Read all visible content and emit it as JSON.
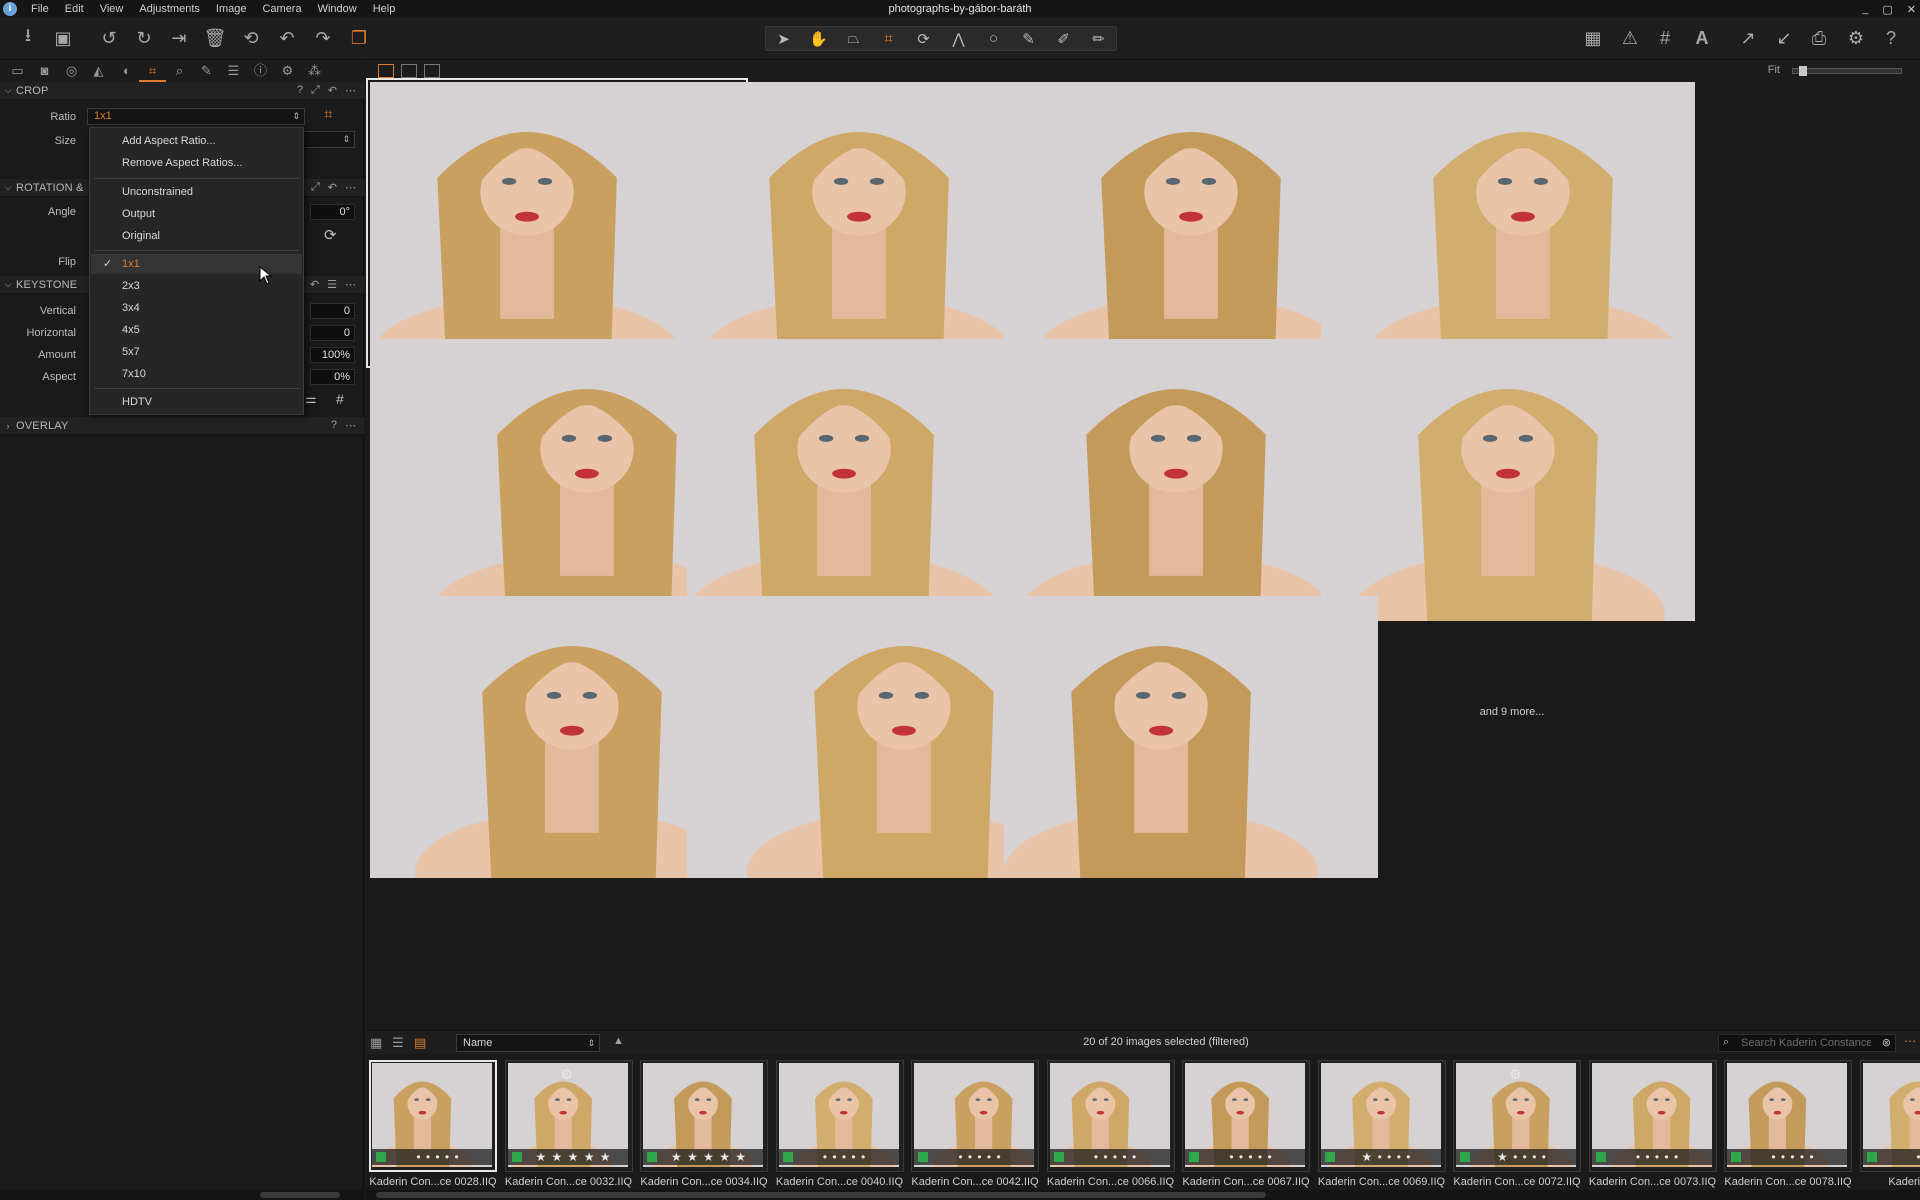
{
  "window": {
    "title": "photographs-by-gábor-baráth",
    "controls": [
      "_",
      "▢",
      "✕"
    ]
  },
  "menu": [
    "File",
    "Edit",
    "View",
    "Adjustments",
    "Image",
    "Camera",
    "Window",
    "Help"
  ],
  "left_panel": {
    "crop": {
      "title": "CROP",
      "ratio_label": "Ratio",
      "ratio_value": "1x1",
      "size_label": "Size"
    },
    "rotation": {
      "title": "ROTATION &",
      "angle_label": "Angle",
      "angle_value": "0°",
      "flip_label": "Flip"
    },
    "keystone": {
      "title": "KEYSTONE",
      "vertical_label": "Vertical",
      "vertical_value": "0",
      "horizontal_label": "Horizontal",
      "horizontal_value": "0",
      "amount_label": "Amount",
      "amount_value": "100%",
      "aspect_label": "Aspect",
      "aspect_value": "0%"
    },
    "overlay": {
      "title": "OVERLAY"
    }
  },
  "ratio_menu": {
    "add": "Add Aspect Ratio...",
    "remove": "Remove Aspect Ratios...",
    "presets": [
      "Unconstrained",
      "Output",
      "Original"
    ],
    "ratios": [
      "1x1",
      "2x3",
      "3x4",
      "4x5",
      "5x7",
      "7x10"
    ],
    "checked": "1x1",
    "extra": "HDTV"
  },
  "viewer": {
    "fit_label": "Fit",
    "more_label": "and 9 more..."
  },
  "browser": {
    "sort_value": "Name",
    "selection_text": "20 of 20 images selected (filtered)",
    "search_placeholder": "Search Kaderin Constance"
  },
  "filmstrip": [
    {
      "name": "Kaderin Con...ce 0028.IIQ",
      "stars": "• • • • •",
      "gear": false,
      "selected": true
    },
    {
      "name": "Kaderin Con...ce 0032.IIQ",
      "stars": "★ ★ ★ ★ ★",
      "gear": true,
      "selected": false
    },
    {
      "name": "Kaderin Con...ce 0034.IIQ",
      "stars": "★ ★ ★ ★ ★",
      "gear": false,
      "selected": false
    },
    {
      "name": "Kaderin Con...ce 0040.IIQ",
      "stars": "• • • • •",
      "gear": false,
      "selected": false
    },
    {
      "name": "Kaderin Con...ce 0042.IIQ",
      "stars": "• • • • •",
      "gear": false,
      "selected": false
    },
    {
      "name": "Kaderin Con...ce 0066.IIQ",
      "stars": "• • • • •",
      "gear": false,
      "selected": false
    },
    {
      "name": "Kaderin Con...ce 0067.IIQ",
      "stars": "• • • • •",
      "gear": false,
      "selected": false
    },
    {
      "name": "Kaderin Con...ce 0069.IIQ",
      "stars": "★ • • • •",
      "gear": false,
      "selected": false
    },
    {
      "name": "Kaderin Con...ce 0072.IIQ",
      "stars": "★ • • • •",
      "gear": true,
      "selected": false
    },
    {
      "name": "Kaderin Con...ce 0073.IIQ",
      "stars": "• • • • •",
      "gear": false,
      "selected": false
    },
    {
      "name": "Kaderin Con...ce 0078.IIQ",
      "stars": "• • • • •",
      "gear": false,
      "selected": false
    },
    {
      "name": "Kaderin Con...",
      "stars": "• • •",
      "gear": false,
      "selected": false
    }
  ],
  "colors": {
    "accent": "#e07a2c",
    "color_tag": "#2ea84a",
    "background": "#1a1a1a"
  }
}
